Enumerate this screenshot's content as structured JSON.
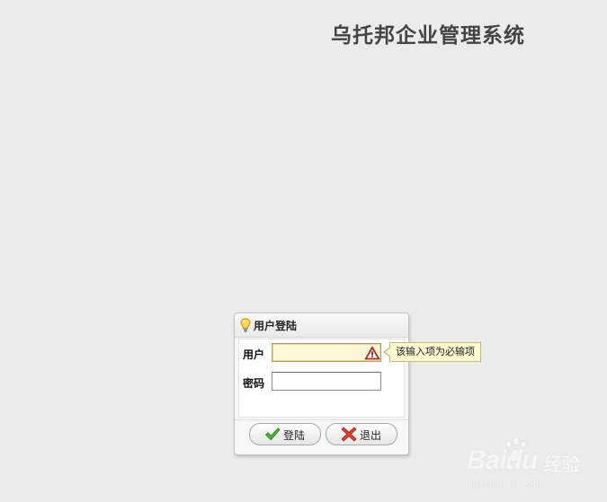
{
  "app": {
    "title": "乌托邦企业管理系统"
  },
  "login_panel": {
    "title": "用户登陆",
    "header_icon": "lightbulb-icon",
    "fields": {
      "username": {
        "label": "用户",
        "value": "",
        "placeholder": "",
        "state": "invalid",
        "status_icon": "warning-icon"
      },
      "password": {
        "label": "密码",
        "value": "",
        "placeholder": ""
      }
    },
    "validation_tooltip": "该输入项为必输项",
    "buttons": {
      "login": {
        "label": "登陆",
        "icon": "check-icon"
      },
      "exit": {
        "label": "退出",
        "icon": "close-icon"
      }
    }
  },
  "watermark": {
    "brand": "Baidu",
    "product": "经验",
    "url": "jingyan.baidu.com"
  },
  "colors": {
    "background": "#ebebeb",
    "invalid_field_bg": "#fdf6d8",
    "tooltip_bg": "#fffbd0",
    "warning_red": "#c0392b",
    "check_green": "#3a9a2a",
    "close_red": "#d23a2a"
  }
}
